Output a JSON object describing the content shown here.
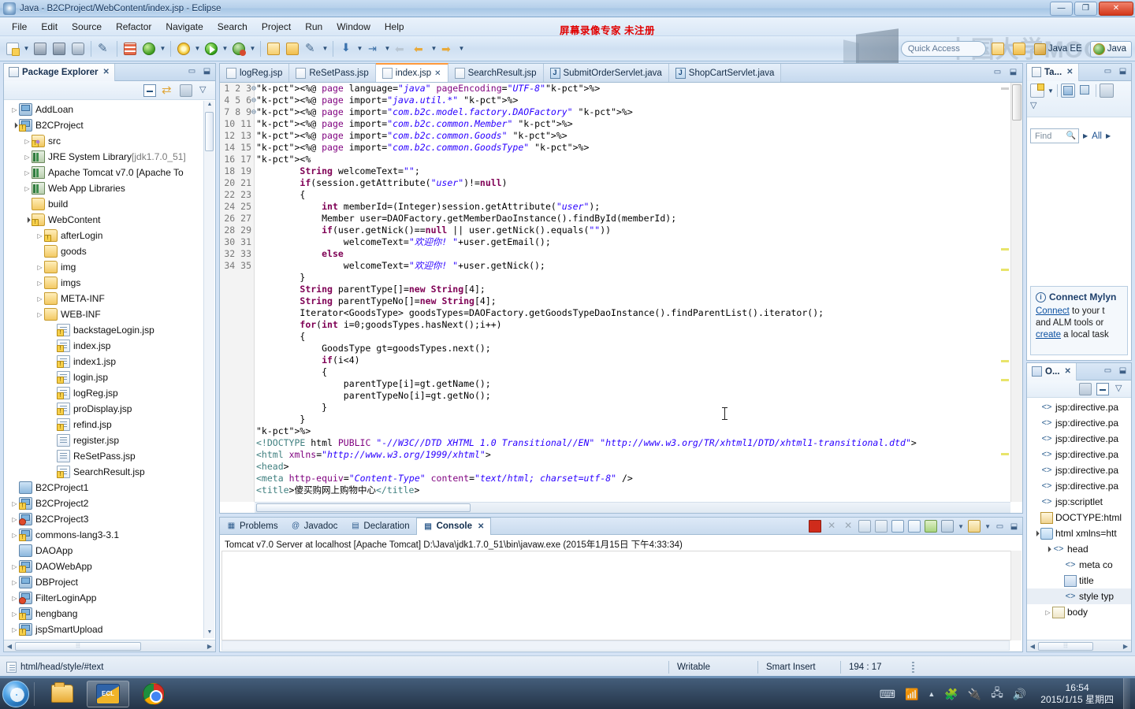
{
  "window": {
    "title": "Java - B2CProject/WebContent/index.jsp - Eclipse",
    "minimize": "—",
    "maximize": "❐",
    "close": "✕"
  },
  "menu": [
    "File",
    "Edit",
    "Source",
    "Refactor",
    "Navigate",
    "Search",
    "Project",
    "Run",
    "Window",
    "Help"
  ],
  "recorder_watermark": "屏幕录像专家  未注册",
  "mooc_watermark": "中国大学MOOC",
  "toolbar": {
    "quick_access_placeholder": "Quick Access",
    "perspectives": [
      {
        "label": "Java EE",
        "active": false
      },
      {
        "label": "Java",
        "active": true
      }
    ]
  },
  "package_explorer": {
    "title": "Package Explorer",
    "close": "✕",
    "tree": [
      {
        "label": "AddLoan",
        "indent": 0,
        "arrow": "closed",
        "icon": "project",
        "badge": ""
      },
      {
        "label": "B2CProject",
        "indent": 0,
        "arrow": "open",
        "icon": "project",
        "badge": "warn"
      },
      {
        "label": "src",
        "indent": 1,
        "arrow": "closed",
        "icon": "srcfolder",
        "badge": "warn"
      },
      {
        "label": "JRE System Library",
        "suffix": " [jdk1.7.0_51]",
        "indent": 1,
        "arrow": "closed",
        "icon": "lib",
        "badge": ""
      },
      {
        "label": "Apache Tomcat v7.0 [Apache To",
        "indent": 1,
        "arrow": "closed",
        "icon": "lib",
        "badge": ""
      },
      {
        "label": "Web App Libraries",
        "indent": 1,
        "arrow": "closed",
        "icon": "lib",
        "badge": ""
      },
      {
        "label": "build",
        "indent": 1,
        "arrow": "none",
        "icon": "folder",
        "badge": ""
      },
      {
        "label": "WebContent",
        "indent": 1,
        "arrow": "open",
        "icon": "folder",
        "badge": "warn"
      },
      {
        "label": "afterLogin",
        "indent": 2,
        "arrow": "closed",
        "icon": "folder",
        "badge": "warn"
      },
      {
        "label": "goods",
        "indent": 2,
        "arrow": "none",
        "icon": "folder",
        "badge": ""
      },
      {
        "label": "img",
        "indent": 2,
        "arrow": "closed",
        "icon": "folder",
        "badge": ""
      },
      {
        "label": "imgs",
        "indent": 2,
        "arrow": "closed",
        "icon": "folder",
        "badge": ""
      },
      {
        "label": "META-INF",
        "indent": 2,
        "arrow": "closed",
        "icon": "folder",
        "badge": ""
      },
      {
        "label": "WEB-INF",
        "indent": 2,
        "arrow": "closed",
        "icon": "folder",
        "badge": ""
      },
      {
        "label": "backstageLogin.jsp",
        "indent": 3,
        "arrow": "none",
        "icon": "jsp",
        "badge": "warn"
      },
      {
        "label": "index.jsp",
        "indent": 3,
        "arrow": "none",
        "icon": "jsp",
        "badge": "warn"
      },
      {
        "label": "index1.jsp",
        "indent": 3,
        "arrow": "none",
        "icon": "jsp",
        "badge": "warn"
      },
      {
        "label": "login.jsp",
        "indent": 3,
        "arrow": "none",
        "icon": "jsp",
        "badge": "warn"
      },
      {
        "label": "logReg.jsp",
        "indent": 3,
        "arrow": "none",
        "icon": "jsp",
        "badge": "warn"
      },
      {
        "label": "proDisplay.jsp",
        "indent": 3,
        "arrow": "none",
        "icon": "jsp",
        "badge": "warn"
      },
      {
        "label": "refind.jsp",
        "indent": 3,
        "arrow": "none",
        "icon": "jsp",
        "badge": "warn"
      },
      {
        "label": "register.jsp",
        "indent": 3,
        "arrow": "none",
        "icon": "jsp",
        "badge": ""
      },
      {
        "label": "ReSetPass.jsp",
        "indent": 3,
        "arrow": "none",
        "icon": "jsp",
        "badge": ""
      },
      {
        "label": "SearchResult.jsp",
        "indent": 3,
        "arrow": "none",
        "icon": "jsp",
        "badge": "warn"
      },
      {
        "label": "B2CProject1",
        "indent": 0,
        "arrow": "none",
        "icon": "plainfolder",
        "badge": ""
      },
      {
        "label": "B2CProject2",
        "indent": 0,
        "arrow": "closed",
        "icon": "project",
        "badge": "warn"
      },
      {
        "label": "B2CProject3",
        "indent": 0,
        "arrow": "closed",
        "icon": "project",
        "badge": "err"
      },
      {
        "label": "commons-lang3-3.1",
        "indent": 0,
        "arrow": "closed",
        "icon": "project",
        "badge": "warn"
      },
      {
        "label": "DAOApp",
        "indent": 0,
        "arrow": "none",
        "icon": "plainfolder",
        "badge": ""
      },
      {
        "label": "DAOWebApp",
        "indent": 0,
        "arrow": "closed",
        "icon": "project",
        "badge": "warn"
      },
      {
        "label": "DBProject",
        "indent": 0,
        "arrow": "closed",
        "icon": "project",
        "badge": ""
      },
      {
        "label": "FilterLoginApp",
        "indent": 0,
        "arrow": "closed",
        "icon": "project",
        "badge": "err"
      },
      {
        "label": "hengbang",
        "indent": 0,
        "arrow": "closed",
        "icon": "project",
        "badge": "warn"
      },
      {
        "label": "jspSmartUpload",
        "indent": 0,
        "arrow": "closed",
        "icon": "project",
        "badge": "warn"
      }
    ]
  },
  "editor": {
    "tabs": [
      {
        "label": "logReg.jsp",
        "type": "jsp",
        "active": false,
        "closable": false
      },
      {
        "label": "ReSetPass.jsp",
        "type": "jsp",
        "active": false,
        "closable": false
      },
      {
        "label": "index.jsp",
        "type": "jsp",
        "active": true,
        "closable": true
      },
      {
        "label": "SearchResult.jsp",
        "type": "jsp",
        "active": false,
        "closable": false
      },
      {
        "label": "SubmitOrderServlet.java",
        "type": "java",
        "active": false,
        "closable": false
      },
      {
        "label": "ShopCartServlet.java",
        "type": "java",
        "active": false,
        "closable": false
      }
    ],
    "first_line": 1,
    "total_visible_lines": 35,
    "lines": [
      "<%@ page language=\"java\" pageEncoding=\"UTF-8\"%>",
      "<%@ page import=\"java.util.*\" %>",
      "<%@ page import=\"com.b2c.model.factory.DAOFactory\" %>",
      "<%@ page import=\"com.b2c.common.Member\" %>",
      "<%@ page import=\"com.b2c.common.Goods\" %>",
      "<%@ page import=\"com.b2c.common.GoodsType\" %>",
      "<%",
      "        String welcomeText=\"\";",
      "        if(session.getAttribute(\"user\")!=null)",
      "        {",
      "            int memberId=(Integer)session.getAttribute(\"user\");",
      "            Member user=DAOFactory.getMemberDaoInstance().findById(memberId);",
      "            if(user.getNick()==null || user.getNick().equals(\"\"))",
      "                welcomeText=\"欢迎你! \"+user.getEmail();",
      "            else",
      "                welcomeText=\"欢迎你! \"+user.getNick();",
      "        }",
      "        String parentType[]=new String[4];",
      "        String parentTypeNo[]=new String[4];",
      "        Iterator<GoodsType> goodsTypes=DAOFactory.getGoodsTypeDaoInstance().findParentList().iterator();",
      "        for(int i=0;goodsTypes.hasNext();i++)",
      "        {",
      "            GoodsType gt=goodsTypes.next();",
      "            if(i<4)",
      "            {",
      "                parentType[i]=gt.getName();",
      "                parentTypeNo[i]=gt.getNo();",
      "            }",
      "        }",
      "%>",
      "<!DOCTYPE html PUBLIC \"-//W3C//DTD XHTML 1.0 Transitional//EN\" \"http://www.w3.org/TR/xhtml1/DTD/xhtml1-transitional.dtd\">",
      "<html xmlns=\"http://www.w3.org/1999/xhtml\">",
      "<head>",
      "<meta http-equiv=\"Content-Type\" content=\"text/html; charset=utf-8\" />",
      "<title>傻买购网上购物中心</title>"
    ],
    "fold_lines": [
      7,
      32,
      33
    ]
  },
  "bottom_panel": {
    "tabs": [
      {
        "label": "Problems",
        "active": false
      },
      {
        "label": "Javadoc",
        "active": false
      },
      {
        "label": "Declaration",
        "active": false
      },
      {
        "label": "Console",
        "active": true,
        "closable": true
      }
    ],
    "console_text": "Tomcat v7.0 Server at localhost [Apache Tomcat] D:\\Java\\jdk1.7.0_51\\bin\\javaw.exe (2015年1月15日 下午4:33:34)"
  },
  "task_list": {
    "title": "Ta...",
    "close": "✕",
    "find_placeholder": "Find",
    "filter_label": "All",
    "mylyn_title": "Connect Mylyn",
    "mylyn_line1_link": "Connect",
    "mylyn_line1_rest": " to your t",
    "mylyn_line2": "and ALM tools or",
    "mylyn_line3_link": "create",
    "mylyn_line3_rest": " a local task"
  },
  "outline": {
    "title": "O...",
    "close": "✕",
    "items": [
      {
        "label": "jsp:directive.pa",
        "icon": "tag",
        "indent": 0,
        "arrow": "none",
        "selected": false
      },
      {
        "label": "jsp:directive.pa",
        "icon": "tag",
        "indent": 0,
        "arrow": "none",
        "selected": false
      },
      {
        "label": "jsp:directive.pa",
        "icon": "tag",
        "indent": 0,
        "arrow": "none",
        "selected": false
      },
      {
        "label": "jsp:directive.pa",
        "icon": "tag",
        "indent": 0,
        "arrow": "none",
        "selected": false
      },
      {
        "label": "jsp:directive.pa",
        "icon": "tag",
        "indent": 0,
        "arrow": "none",
        "selected": false
      },
      {
        "label": "jsp:directive.pa",
        "icon": "tag",
        "indent": 0,
        "arrow": "none",
        "selected": false
      },
      {
        "label": "jsp:scriptlet",
        "icon": "tag",
        "indent": 0,
        "arrow": "none",
        "selected": false
      },
      {
        "label": "DOCTYPE:html",
        "icon": "doctype",
        "indent": 0,
        "arrow": "none",
        "selected": false
      },
      {
        "label": "html xmlns=htt",
        "icon": "html",
        "indent": 0,
        "arrow": "open",
        "selected": false
      },
      {
        "label": "head",
        "icon": "tag",
        "indent": 1,
        "arrow": "open",
        "selected": false
      },
      {
        "label": "meta co",
        "icon": "tag",
        "indent": 2,
        "arrow": "none",
        "selected": false
      },
      {
        "label": "title",
        "icon": "title",
        "indent": 2,
        "arrow": "none",
        "selected": false
      },
      {
        "label": "style typ",
        "icon": "tag",
        "indent": 2,
        "arrow": "none",
        "selected": true
      },
      {
        "label": "body",
        "icon": "body",
        "indent": 1,
        "arrow": "closed",
        "selected": false
      }
    ]
  },
  "status_bar": {
    "path": "html/head/style/#text",
    "writable": "Writable",
    "insert_mode": "Smart Insert",
    "position": "194 : 17"
  },
  "taskbar": {
    "apps": [
      {
        "name": "explorer",
        "active": false
      },
      {
        "name": "eclipse",
        "active": true
      },
      {
        "name": "chrome",
        "active": false
      }
    ],
    "time": "16:54",
    "date": "2015/1/15 星期四"
  },
  "colors": {
    "accent": "#2a5d9f",
    "warn": "#f7d04a",
    "error": "#e04a2b",
    "string": "#2a00ff",
    "keyword": "#7f0055",
    "directive": "#7f007f",
    "tag": "#3f7f7f",
    "recorder_red": "#e00000"
  }
}
